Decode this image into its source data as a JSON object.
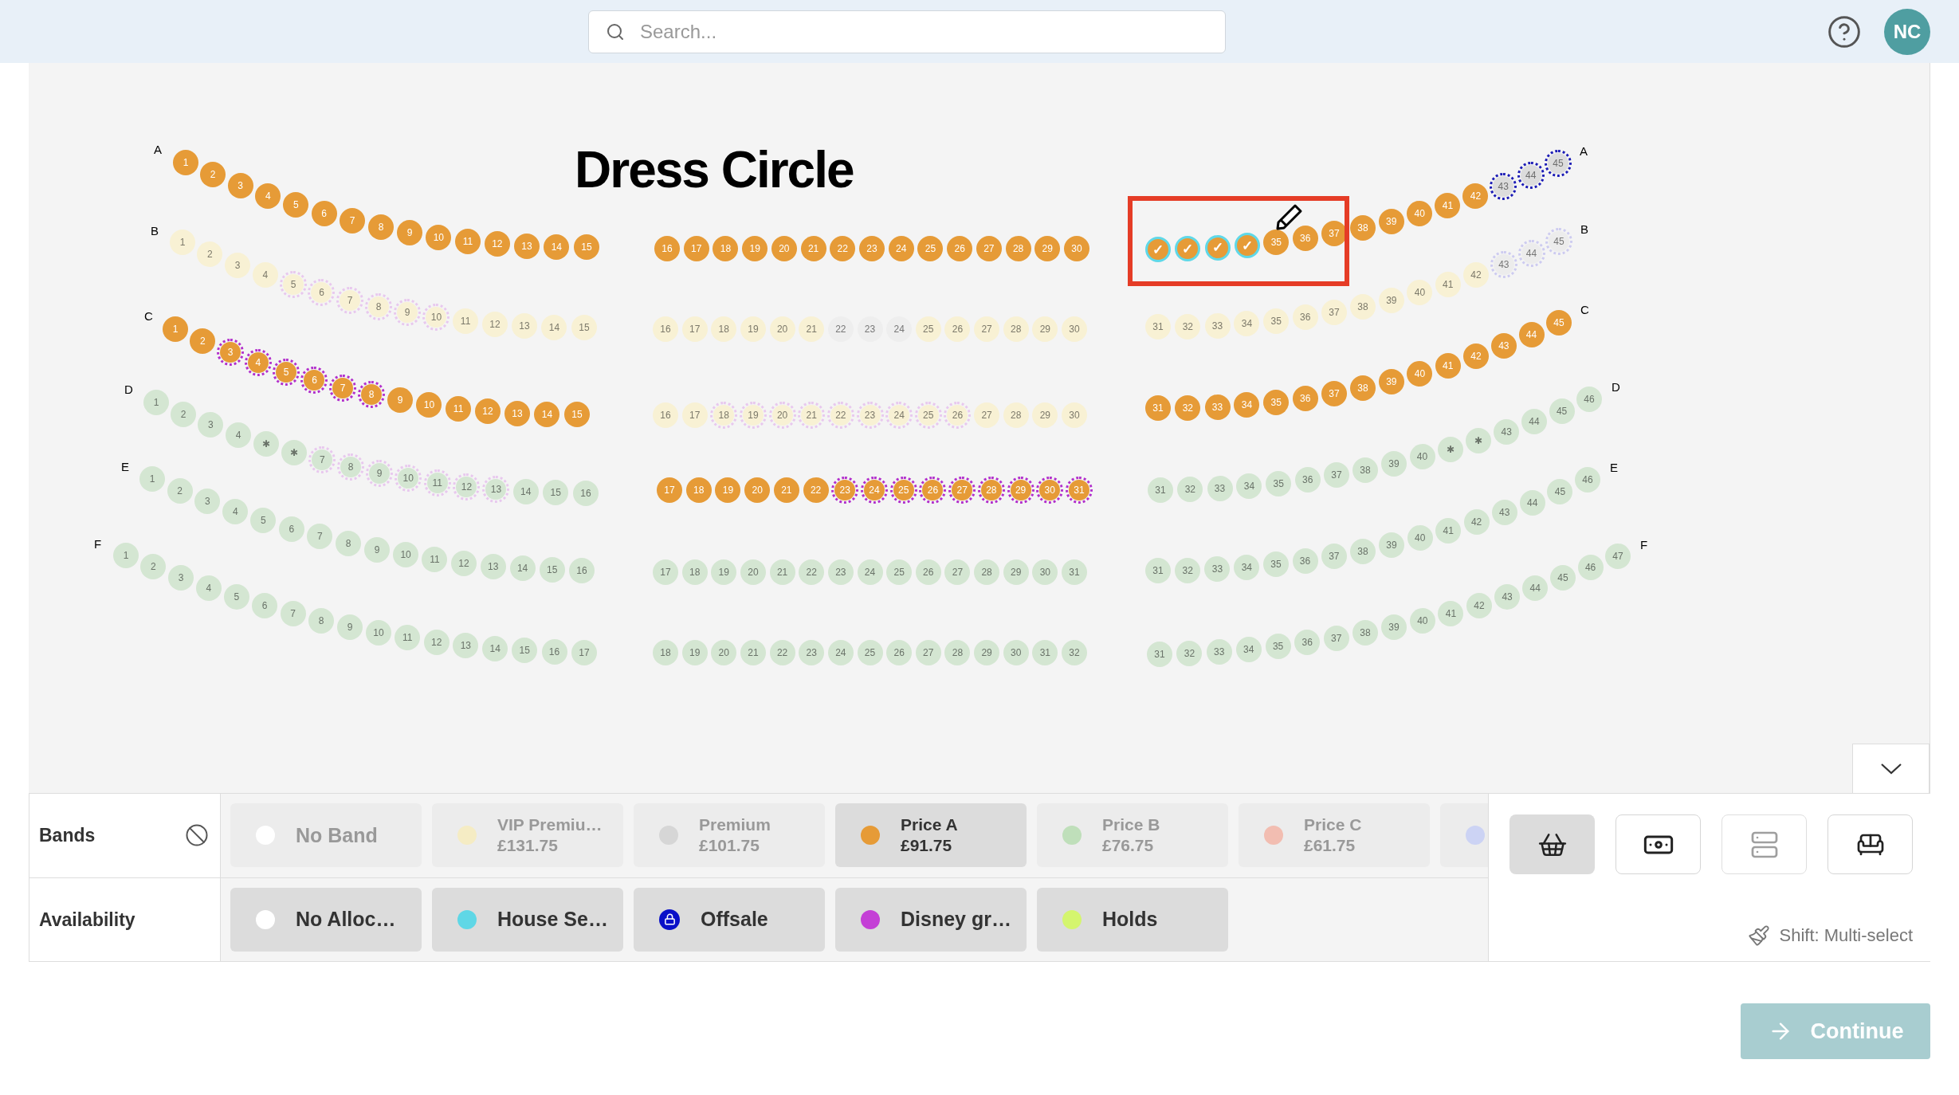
{
  "header": {
    "search": {
      "placeholder": "Search..."
    },
    "avatar": "NC"
  },
  "seatmap": {
    "title": "Dress Circle",
    "rows": [
      {
        "label_left": "A",
        "label_right": "A",
        "sections": [
          {
            "runs": [
              {
                "color": "#e69b37",
                "selected": false,
                "seats": [
                  "1",
                  "2",
                  "3",
                  "4",
                  "5",
                  "6",
                  "7",
                  "8",
                  "9",
                  "10",
                  "11",
                  "12",
                  "13",
                  "14",
                  "15"
                ]
              }
            ]
          },
          {
            "runs": [
              {
                "color": "#e69b37",
                "selected": false,
                "seats": [
                  "16",
                  "17",
                  "18",
                  "19",
                  "20",
                  "21",
                  "22",
                  "23",
                  "24",
                  "25",
                  "26",
                  "27",
                  "28",
                  "29",
                  "30"
                ]
              }
            ]
          },
          {
            "runs": [
              {
                "color": "#e69b37",
                "selected": true,
                "seats": [
                  "✓",
                  "✓",
                  "✓",
                  "✓"
                ]
              },
              {
                "color": "#e69b37",
                "selected": false,
                "seats": [
                  "35",
                  "36",
                  "37",
                  "38",
                  "39",
                  "40",
                  "41",
                  "42"
                ]
              },
              {
                "color": "#dcdcdc",
                "outline": {
                  "color": "#1b1bb5"
                },
                "selected": false,
                "seats": [
                  "43",
                  "44",
                  "45"
                ]
              }
            ]
          }
        ]
      },
      {
        "label_left": "B",
        "label_right": "B",
        "sections": [
          {
            "runs": [
              {
                "color": "#f8f1d4",
                "selected": false,
                "seats": [
                  "1",
                  "2",
                  "3",
                  "4"
                ]
              },
              {
                "color": "#f8f1d4",
                "outline": {
                  "color": "#e8c8ee"
                },
                "selected": false,
                "seats": [
                  "5",
                  "6",
                  "7",
                  "8",
                  "9",
                  "10"
                ]
              },
              {
                "color": "#f8f1d4",
                "selected": false,
                "seats": [
                  "11",
                  "12",
                  "13",
                  "14",
                  "15"
                ]
              }
            ]
          },
          {
            "runs": [
              {
                "color": "#f8f1d4",
                "selected": false,
                "seats": [
                  "16",
                  "17",
                  "18",
                  "19",
                  "20",
                  "21"
                ]
              },
              {
                "color": "#eeeeee",
                "selected": false,
                "seats": [
                  "22",
                  "23",
                  "24"
                ]
              },
              {
                "color": "#f8f1d4",
                "selected": false,
                "seats": [
                  "25",
                  "26",
                  "27",
                  "28",
                  "29",
                  "30"
                ]
              }
            ]
          },
          {
            "runs": [
              {
                "color": "#f8f1d4",
                "selected": false,
                "seats": [
                  "31",
                  "32",
                  "33",
                  "34",
                  "35",
                  "36",
                  "37",
                  "38",
                  "39",
                  "40",
                  "41",
                  "42"
                ]
              },
              {
                "color": "#ececec",
                "outline": {
                  "color": "#cdcbf0"
                },
                "selected": false,
                "seats": [
                  "43",
                  "44",
                  "45"
                ]
              }
            ]
          }
        ]
      },
      {
        "label_left": "C",
        "label_right": "C",
        "sections": [
          {
            "runs": [
              {
                "color": "#e69b37",
                "selected": false,
                "seats": [
                  "1",
                  "2"
                ]
              },
              {
                "color": "#e69b37",
                "outline": {
                  "color": "#b22fcc"
                },
                "selected": false,
                "seats": [
                  "3",
                  "4",
                  "5",
                  "6",
                  "7",
                  "8"
                ]
              },
              {
                "color": "#e69b37",
                "selected": false,
                "seats": [
                  "9",
                  "10",
                  "11",
                  "12",
                  "13",
                  "14",
                  "15"
                ]
              }
            ]
          },
          {
            "runs": [
              {
                "color": "#f8f1d4",
                "selected": false,
                "seats": [
                  "16",
                  "17"
                ]
              },
              {
                "color": "#f8f1d4",
                "outline": {
                  "color": "#e8c8ee"
                },
                "selected": false,
                "seats": [
                  "18",
                  "19",
                  "20",
                  "21",
                  "22",
                  "23",
                  "24",
                  "25",
                  "26"
                ]
              },
              {
                "color": "#f8f1d4",
                "selected": false,
                "seats": [
                  "27",
                  "28",
                  "29",
                  "30"
                ]
              }
            ]
          },
          {
            "runs": [
              {
                "color": "#e69b37",
                "selected": false,
                "seats": [
                  "31",
                  "32",
                  "33",
                  "34",
                  "35",
                  "36",
                  "37",
                  "38",
                  "39",
                  "40",
                  "41",
                  "42",
                  "43",
                  "44",
                  "45"
                ]
              }
            ]
          }
        ]
      },
      {
        "label_left": "D",
        "label_right": "D",
        "sections": [
          {
            "runs": [
              {
                "color": "#d4e6d2",
                "selected": false,
                "seats": [
                  "1",
                  "2",
                  "3",
                  "4",
                  "✱",
                  "✱"
                ]
              },
              {
                "color": "#d4e6d2",
                "outline": {
                  "color": "#e8c8ee"
                },
                "selected": false,
                "seats": [
                  "7",
                  "8",
                  "9",
                  "10",
                  "11",
                  "12",
                  "13"
                ]
              },
              {
                "color": "#d4e6d2",
                "selected": false,
                "seats": [
                  "14",
                  "15",
                  "16"
                ]
              }
            ]
          },
          {
            "runs": [
              {
                "color": "#e69b37",
                "selected": false,
                "seats": [
                  "17",
                  "18",
                  "19",
                  "20",
                  "21",
                  "22"
                ]
              },
              {
                "color": "#e69b37",
                "outline": {
                  "color": "#b22fcc"
                },
                "selected": false,
                "seats": [
                  "23",
                  "24",
                  "25",
                  "26",
                  "27",
                  "28",
                  "29",
                  "30",
                  "31"
                ]
              }
            ]
          },
          {
            "runs": [
              {
                "color": "#d4e6d2",
                "selected": false,
                "seats": [
                  "31",
                  "32",
                  "33",
                  "34",
                  "35",
                  "36",
                  "37",
                  "38",
                  "39",
                  "40",
                  "✱",
                  "✱",
                  "43",
                  "44",
                  "45",
                  "46"
                ]
              }
            ]
          }
        ]
      },
      {
        "label_left": "E",
        "label_right": "E",
        "sections": [
          {
            "runs": [
              {
                "color": "#d4e6d2",
                "selected": false,
                "seats": [
                  "1",
                  "2",
                  "3",
                  "4",
                  "5",
                  "6",
                  "7",
                  "8",
                  "9",
                  "10",
                  "11",
                  "12",
                  "13",
                  "14",
                  "15",
                  "16"
                ]
              }
            ]
          },
          {
            "runs": [
              {
                "color": "#d4e6d2",
                "selected": false,
                "seats": [
                  "17",
                  "18",
                  "19",
                  "20",
                  "21",
                  "22",
                  "23",
                  "24",
                  "25",
                  "26",
                  "27",
                  "28",
                  "29",
                  "30",
                  "31"
                ]
              }
            ]
          },
          {
            "runs": [
              {
                "color": "#d4e6d2",
                "selected": false,
                "seats": [
                  "31",
                  "32",
                  "33",
                  "34",
                  "35",
                  "36",
                  "37",
                  "38",
                  "39",
                  "40",
                  "41",
                  "42",
                  "43",
                  "44",
                  "45",
                  "46"
                ]
              }
            ]
          }
        ]
      },
      {
        "label_left": "F",
        "label_right": "F",
        "sections": [
          {
            "runs": [
              {
                "color": "#d4e6d2",
                "selected": false,
                "seats": [
                  "1",
                  "2",
                  "3",
                  "4",
                  "5",
                  "6",
                  "7",
                  "8",
                  "9",
                  "10",
                  "11",
                  "12",
                  "13",
                  "14",
                  "15",
                  "16",
                  "17"
                ]
              }
            ]
          },
          {
            "runs": [
              {
                "color": "#d4e6d2",
                "selected": false,
                "seats": [
                  "18",
                  "19",
                  "20",
                  "21",
                  "22",
                  "23",
                  "24",
                  "25",
                  "26",
                  "27",
                  "28",
                  "29",
                  "30",
                  "31",
                  "32"
                ]
              }
            ]
          },
          {
            "runs": [
              {
                "color": "#d4e6d2",
                "selected": false,
                "seats": [
                  "31",
                  "32",
                  "33",
                  "34",
                  "35",
                  "36",
                  "37",
                  "38",
                  "39",
                  "40",
                  "41",
                  "42",
                  "43",
                  "44",
                  "45",
                  "46",
                  "47"
                ]
              }
            ]
          }
        ]
      }
    ]
  },
  "bands": {
    "title": "Bands",
    "items": [
      {
        "label": "No Band",
        "color": "#ffffff",
        "selected": false
      },
      {
        "label": "VIP Premiu…",
        "price": "£131.75",
        "color": "#f5ecc4",
        "selected": false
      },
      {
        "label": "Premium",
        "price": "£101.75",
        "color": "#d6d6d6",
        "selected": false
      },
      {
        "label": "Price A",
        "price": "£91.75",
        "color": "#e69b37",
        "selected": true
      },
      {
        "label": "Price B",
        "price": "£76.75",
        "color": "#bfdfba",
        "selected": false
      },
      {
        "label": "Price C",
        "price": "£61.75",
        "color": "#f2bdb1",
        "selected": false
      },
      {
        "color": "#ccd3f4",
        "selected": false
      }
    ]
  },
  "availability": {
    "title": "Availability",
    "items": [
      {
        "kind": "dot",
        "label": "No Alloc…",
        "color": "#ffffff"
      },
      {
        "kind": "dot",
        "label": "House Se…",
        "color": "#5fd7e6"
      },
      {
        "kind": "lock",
        "label": "Offsale",
        "color": "#0a10c8"
      },
      {
        "kind": "dot",
        "label": "Disney gr…",
        "color": "#c43fd6"
      },
      {
        "kind": "dot",
        "label": "Holds",
        "color": "#d4f56e"
      }
    ]
  },
  "tools": [
    {
      "kind": "basket",
      "selected": true,
      "disabled": false
    },
    {
      "kind": "banknote",
      "selected": false,
      "disabled": false
    },
    {
      "kind": "stack",
      "selected": false,
      "disabled": true
    },
    {
      "kind": "sofa",
      "selected": false,
      "disabled": false
    }
  ],
  "hint": "Shift: Multi-select",
  "continue": "Continue"
}
